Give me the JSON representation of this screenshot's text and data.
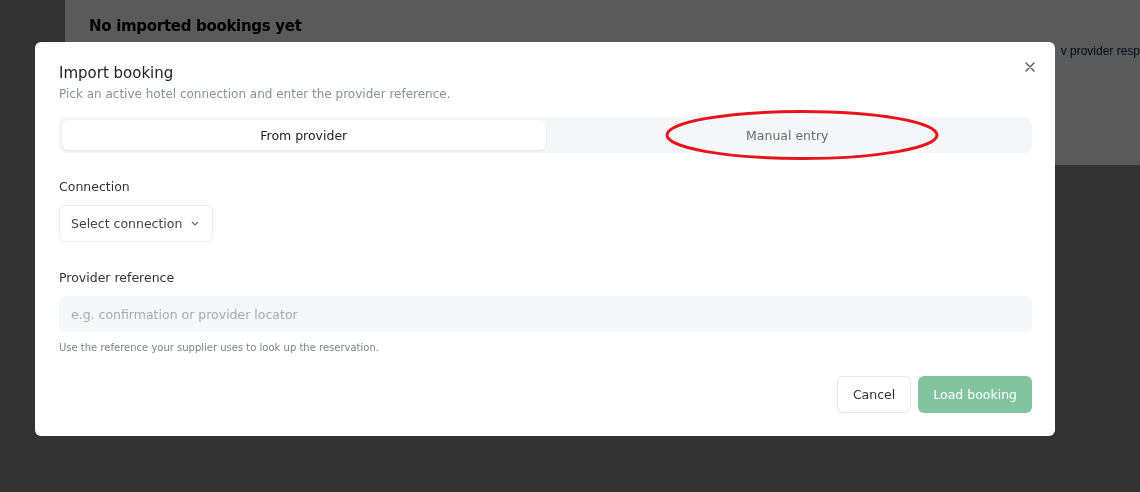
{
  "background_page": {
    "heading": "No imported bookings yet",
    "link_fragment": "v provider resp"
  },
  "dialog": {
    "title": "Import booking",
    "subtitle": "Pick an active hotel connection and enter the provider reference.",
    "tabs": [
      {
        "label": "From provider",
        "selected": true,
        "circled": false
      },
      {
        "label": "Manual entry",
        "selected": false,
        "circled": true
      }
    ],
    "connection": {
      "label": "Connection",
      "value": "Select connection"
    },
    "provider_reference": {
      "label": "Provider reference",
      "placeholder": "e.g. confirmation or provider locator",
      "hint": "Use the reference your supplier uses to look up the reservation."
    },
    "buttons": [
      {
        "label": "Cancel",
        "kind": "secondary",
        "disabled": false
      },
      {
        "label": "Load booking",
        "kind": "primary",
        "disabled": true
      }
    ]
  }
}
